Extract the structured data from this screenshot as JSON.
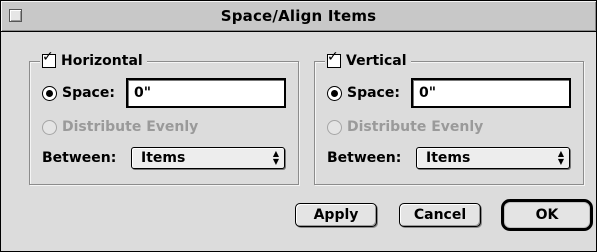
{
  "window": {
    "title": "Space/Align Items"
  },
  "horizontal": {
    "checkbox_label": "Horizontal",
    "checked": true,
    "space_label": "Space:",
    "space_value": "0\"",
    "distribute_label": "Distribute Evenly",
    "between_label": "Between:",
    "between_value": "Items"
  },
  "vertical": {
    "checkbox_label": "Vertical",
    "checked": true,
    "space_label": "Space:",
    "space_value": "0\"",
    "distribute_label": "Distribute Evenly",
    "between_label": "Between:",
    "between_value": "Items"
  },
  "buttons": {
    "apply": "Apply",
    "cancel": "Cancel",
    "ok": "OK"
  },
  "icons": {
    "check": "✓",
    "popup_up": "▲",
    "popup_down": "▼"
  }
}
